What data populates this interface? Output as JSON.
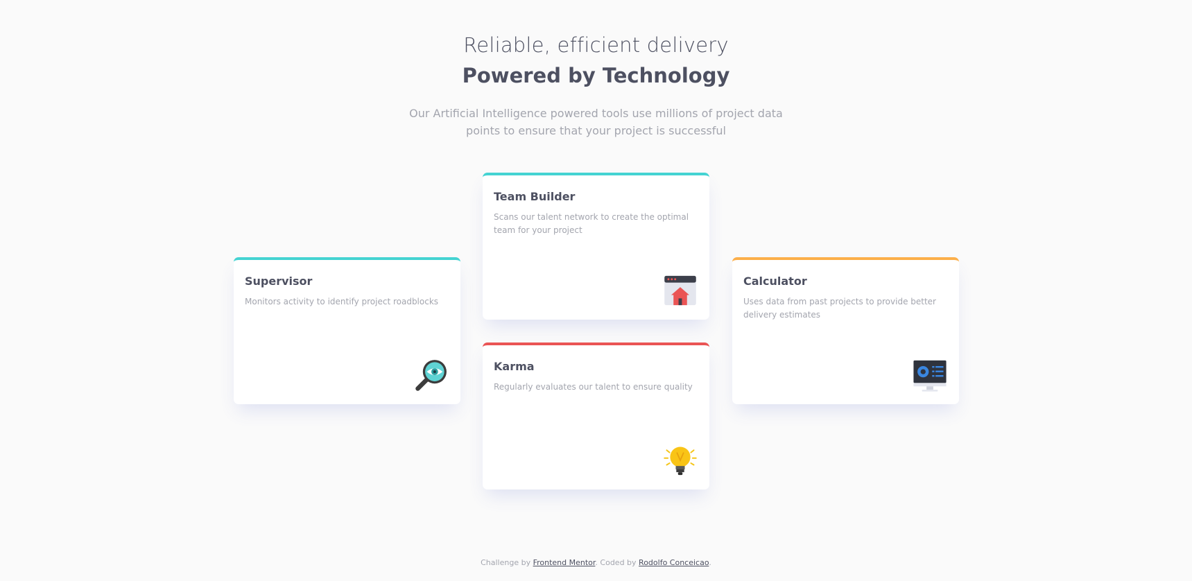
{
  "header": {
    "subtitle": "Reliable, efficient delivery",
    "title": "Powered by Technology",
    "intro": "Our Artificial Intelligence powered tools use millions of project data points to ensure that your project is successful"
  },
  "cards": {
    "supervisor": {
      "title": "Supervisor",
      "description": "Monitors activity to identify project roadblocks",
      "accent": "#44d3d2",
      "icon": "magnifier-eye-icon"
    },
    "team_builder": {
      "title": "Team Builder",
      "description": "Scans our talent network to create the optimal team for your project",
      "accent": "#44d3d2",
      "icon": "browser-home-icon"
    },
    "karma": {
      "title": "Karma",
      "description": "Regularly evaluates our talent to ensure quality",
      "accent": "#ea5454",
      "icon": "lightbulb-icon"
    },
    "calculator": {
      "title": "Calculator",
      "description": "Uses data from past projects to provide better delivery estimates",
      "accent": "#fcaf4a",
      "icon": "monitor-chart-icon"
    }
  },
  "footer": {
    "prefix": "Challenge by ",
    "link1": "Frontend Mentor",
    "middle": ". Coded by ",
    "link2": "Rodolfo Conceicao",
    "suffix": "."
  },
  "colors": {
    "background": "#fafafa",
    "heading": "#4d5061",
    "muted": "#a3a5ae",
    "cyan": "#44d3d2",
    "red": "#ea5454",
    "orange": "#fcaf4a"
  }
}
